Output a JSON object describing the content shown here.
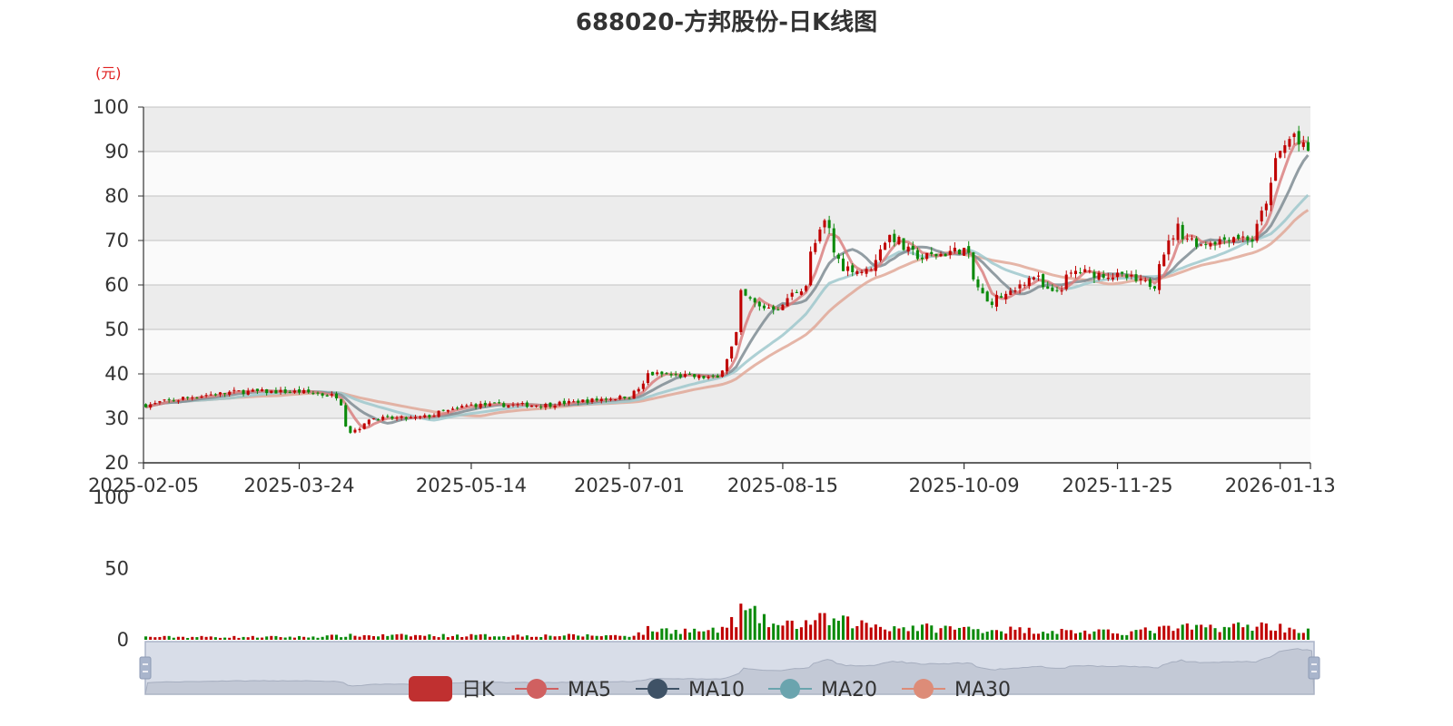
{
  "chart_data": {
    "type": "candlestick",
    "title": "688020-方邦股份-日K线图",
    "price_unit_label": "(元)",
    "price_axis": {
      "ylim": [
        20,
        100
      ],
      "ticks": [
        "100",
        "90",
        "80",
        "70",
        "60",
        "50",
        "40",
        "30",
        "20"
      ]
    },
    "volume_axis": {
      "ylim": [
        0,
        100
      ],
      "ticks": [
        "100",
        "50",
        "0"
      ]
    },
    "x_tick_labels": [
      "2025-02-05",
      "2025-03-24",
      "2025-05-14",
      "2025-07-01",
      "2025-08-15",
      "2025-10-09",
      "2025-11-25",
      "2026-01-13"
    ],
    "legend": [
      "日K",
      "MA5",
      "MA10",
      "MA20",
      "MA30"
    ],
    "colors": {
      "up": "#c00000",
      "down": "#0a8a0a",
      "ma5": "#d98080",
      "ma10": "#7f8c93",
      "ma20": "#9fc8cc",
      "ma30": "#e0a898",
      "grid": "#cccccc",
      "band": "#ececec",
      "band_alt": "#fafafa",
      "slider_fill": "#d8dde8",
      "slider_border": "#aab4c8"
    },
    "grid": true,
    "legend_position": "bottom",
    "close_anchor_points": [
      {
        "t": "2025-02-05",
        "close": 33
      },
      {
        "t": "2025-02-20",
        "close": 35
      },
      {
        "t": "2025-03-05",
        "close": 36
      },
      {
        "t": "2025-03-24",
        "close": 36
      },
      {
        "t": "2025-04-03",
        "close": 35
      },
      {
        "t": "2025-04-08",
        "close": 27
      },
      {
        "t": "2025-04-14",
        "close": 30
      },
      {
        "t": "2025-04-28",
        "close": 30
      },
      {
        "t": "2025-05-14",
        "close": 33
      },
      {
        "t": "2025-06-05",
        "close": 33
      },
      {
        "t": "2025-07-01",
        "close": 35
      },
      {
        "t": "2025-07-07",
        "close": 40
      },
      {
        "t": "2025-07-28",
        "close": 39
      },
      {
        "t": "2025-07-31",
        "close": 46
      },
      {
        "t": "2025-08-04",
        "close": 58
      },
      {
        "t": "2025-08-08",
        "close": 55
      },
      {
        "t": "2025-08-15",
        "close": 55
      },
      {
        "t": "2025-08-22",
        "close": 60
      },
      {
        "t": "2025-08-28",
        "close": 74
      },
      {
        "t": "2025-09-03",
        "close": 64
      },
      {
        "t": "2025-09-10",
        "close": 63
      },
      {
        "t": "2025-09-17",
        "close": 71
      },
      {
        "t": "2025-09-26",
        "close": 66
      },
      {
        "t": "2025-10-09",
        "close": 68
      },
      {
        "t": "2025-10-16",
        "close": 56
      },
      {
        "t": "2025-10-23",
        "close": 58
      },
      {
        "t": "2025-10-30",
        "close": 62
      },
      {
        "t": "2025-11-05",
        "close": 58
      },
      {
        "t": "2025-11-12",
        "close": 63
      },
      {
        "t": "2025-11-25",
        "close": 62
      },
      {
        "t": "2025-12-05",
        "close": 60
      },
      {
        "t": "2025-12-12",
        "close": 73
      },
      {
        "t": "2025-12-19",
        "close": 69
      },
      {
        "t": "2025-12-30",
        "close": 71
      },
      {
        "t": "2026-01-05",
        "close": 70
      },
      {
        "t": "2026-01-09",
        "close": 82
      },
      {
        "t": "2026-01-13",
        "close": 90
      },
      {
        "t": "2026-01-16",
        "close": 94
      },
      {
        "t": "2026-01-21",
        "close": 90
      }
    ],
    "volume_anchor_points": [
      {
        "t": "2025-02-05",
        "volume": 2
      },
      {
        "t": "2025-03-24",
        "volume": 2
      },
      {
        "t": "2025-04-08",
        "volume": 3
      },
      {
        "t": "2025-07-01",
        "volume": 3
      },
      {
        "t": "2025-07-07",
        "volume": 7
      },
      {
        "t": "2025-07-28",
        "volume": 6
      },
      {
        "t": "2025-08-04",
        "volume": 20
      },
      {
        "t": "2025-08-15",
        "volume": 9
      },
      {
        "t": "2025-08-28",
        "volume": 14
      },
      {
        "t": "2025-09-17",
        "volume": 9
      },
      {
        "t": "2025-10-23",
        "volume": 7
      },
      {
        "t": "2025-11-25",
        "volume": 5
      },
      {
        "t": "2025-12-12",
        "volume": 8
      },
      {
        "t": "2026-01-09",
        "volume": 10
      },
      {
        "t": "2026-01-21",
        "volume": 6
      }
    ]
  }
}
